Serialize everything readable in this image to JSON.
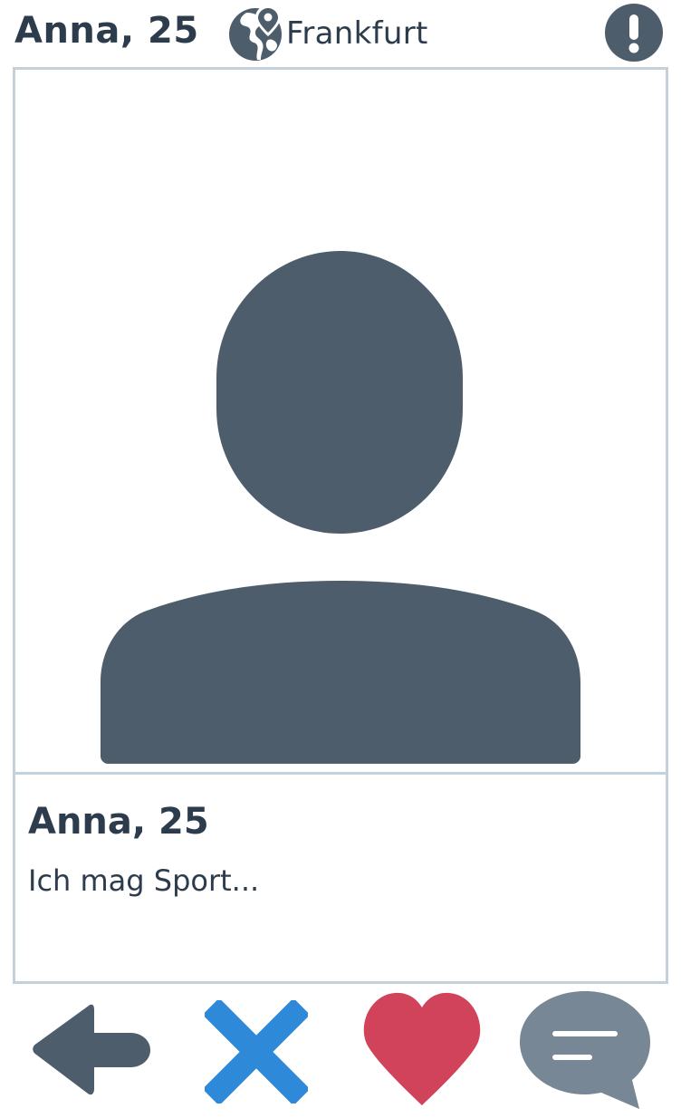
{
  "header": {
    "name_age": "Anna, 25",
    "location": "Frankfurt",
    "location_icon": "globe-location-icon",
    "report_icon": "exclamation-icon"
  },
  "profile": {
    "photo_placeholder_icon": "user-silhouette-icon",
    "name_age": "Anna, 25",
    "bio": "Ich mag Sport..."
  },
  "actions": [
    {
      "id": "back",
      "icon": "arrow-left-icon"
    },
    {
      "id": "dislike",
      "icon": "close-icon"
    },
    {
      "id": "like",
      "icon": "heart-icon"
    },
    {
      "id": "message",
      "icon": "chat-bubble-icon"
    }
  ],
  "colors": {
    "text": "#2d3c4d",
    "icon_dark": "#4d5d6b",
    "border": "#c5d1da",
    "dislike_blue": "#2e89d8",
    "like_red": "#d1435a",
    "chat_gray": "#788795"
  }
}
